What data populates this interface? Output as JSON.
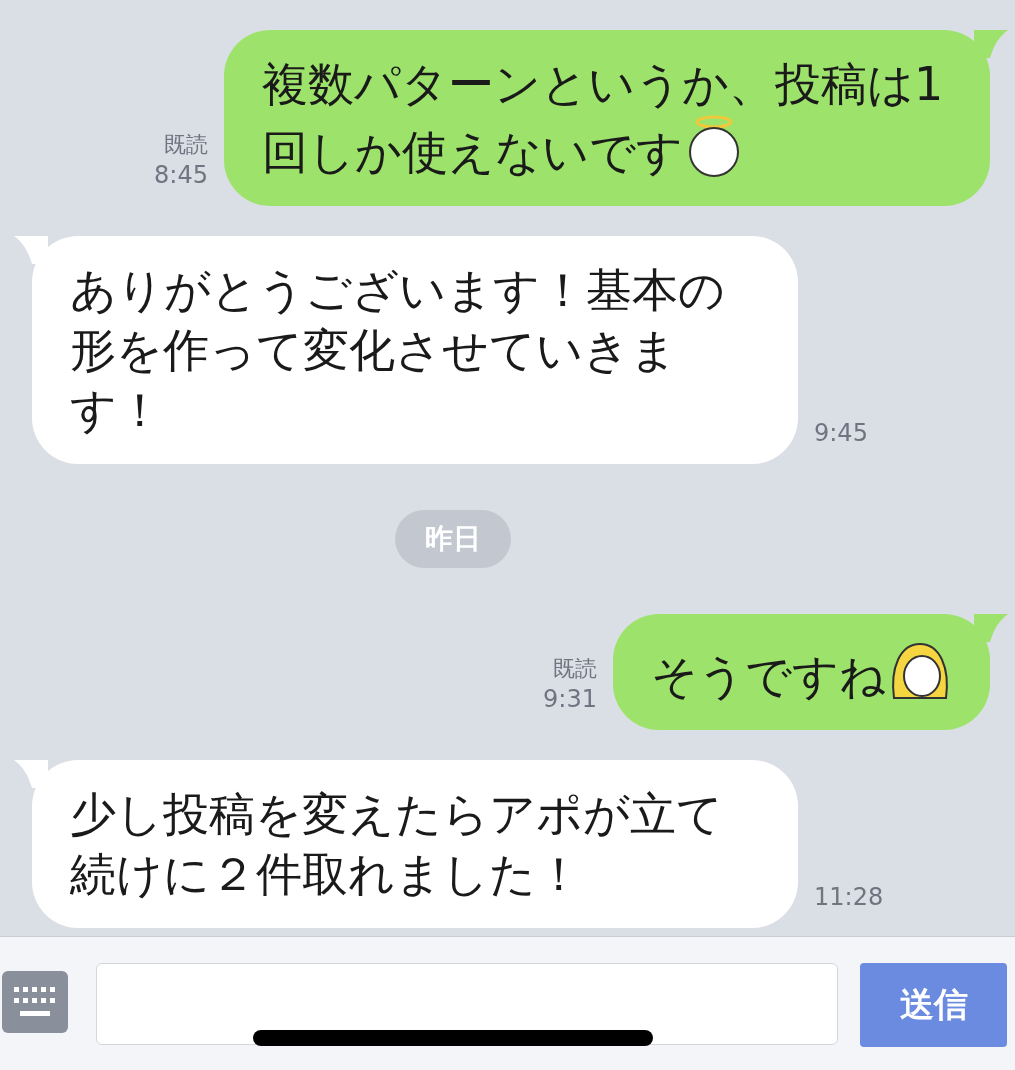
{
  "chat": [
    {
      "kind": "sent",
      "text": "複数パターンというか、投稿は1回しか使えないです",
      "emoji": {
        "kind": "halo"
      },
      "read": "既読",
      "time": "8:45"
    },
    {
      "kind": "received",
      "text": "ありがとうございます！基本の形を作って変化させていきます！",
      "time": "9:45"
    },
    {
      "kind": "date",
      "text": "昨日"
    },
    {
      "kind": "sent",
      "text": "そうですね",
      "emoji": {
        "kind": "hair"
      },
      "read": "既読",
      "time": "9:31"
    },
    {
      "kind": "received",
      "text": "少し投稿を変えたらアポが立て続けに２件取れました！",
      "time": "11:28"
    }
  ],
  "composer": {
    "send": "送信"
  }
}
